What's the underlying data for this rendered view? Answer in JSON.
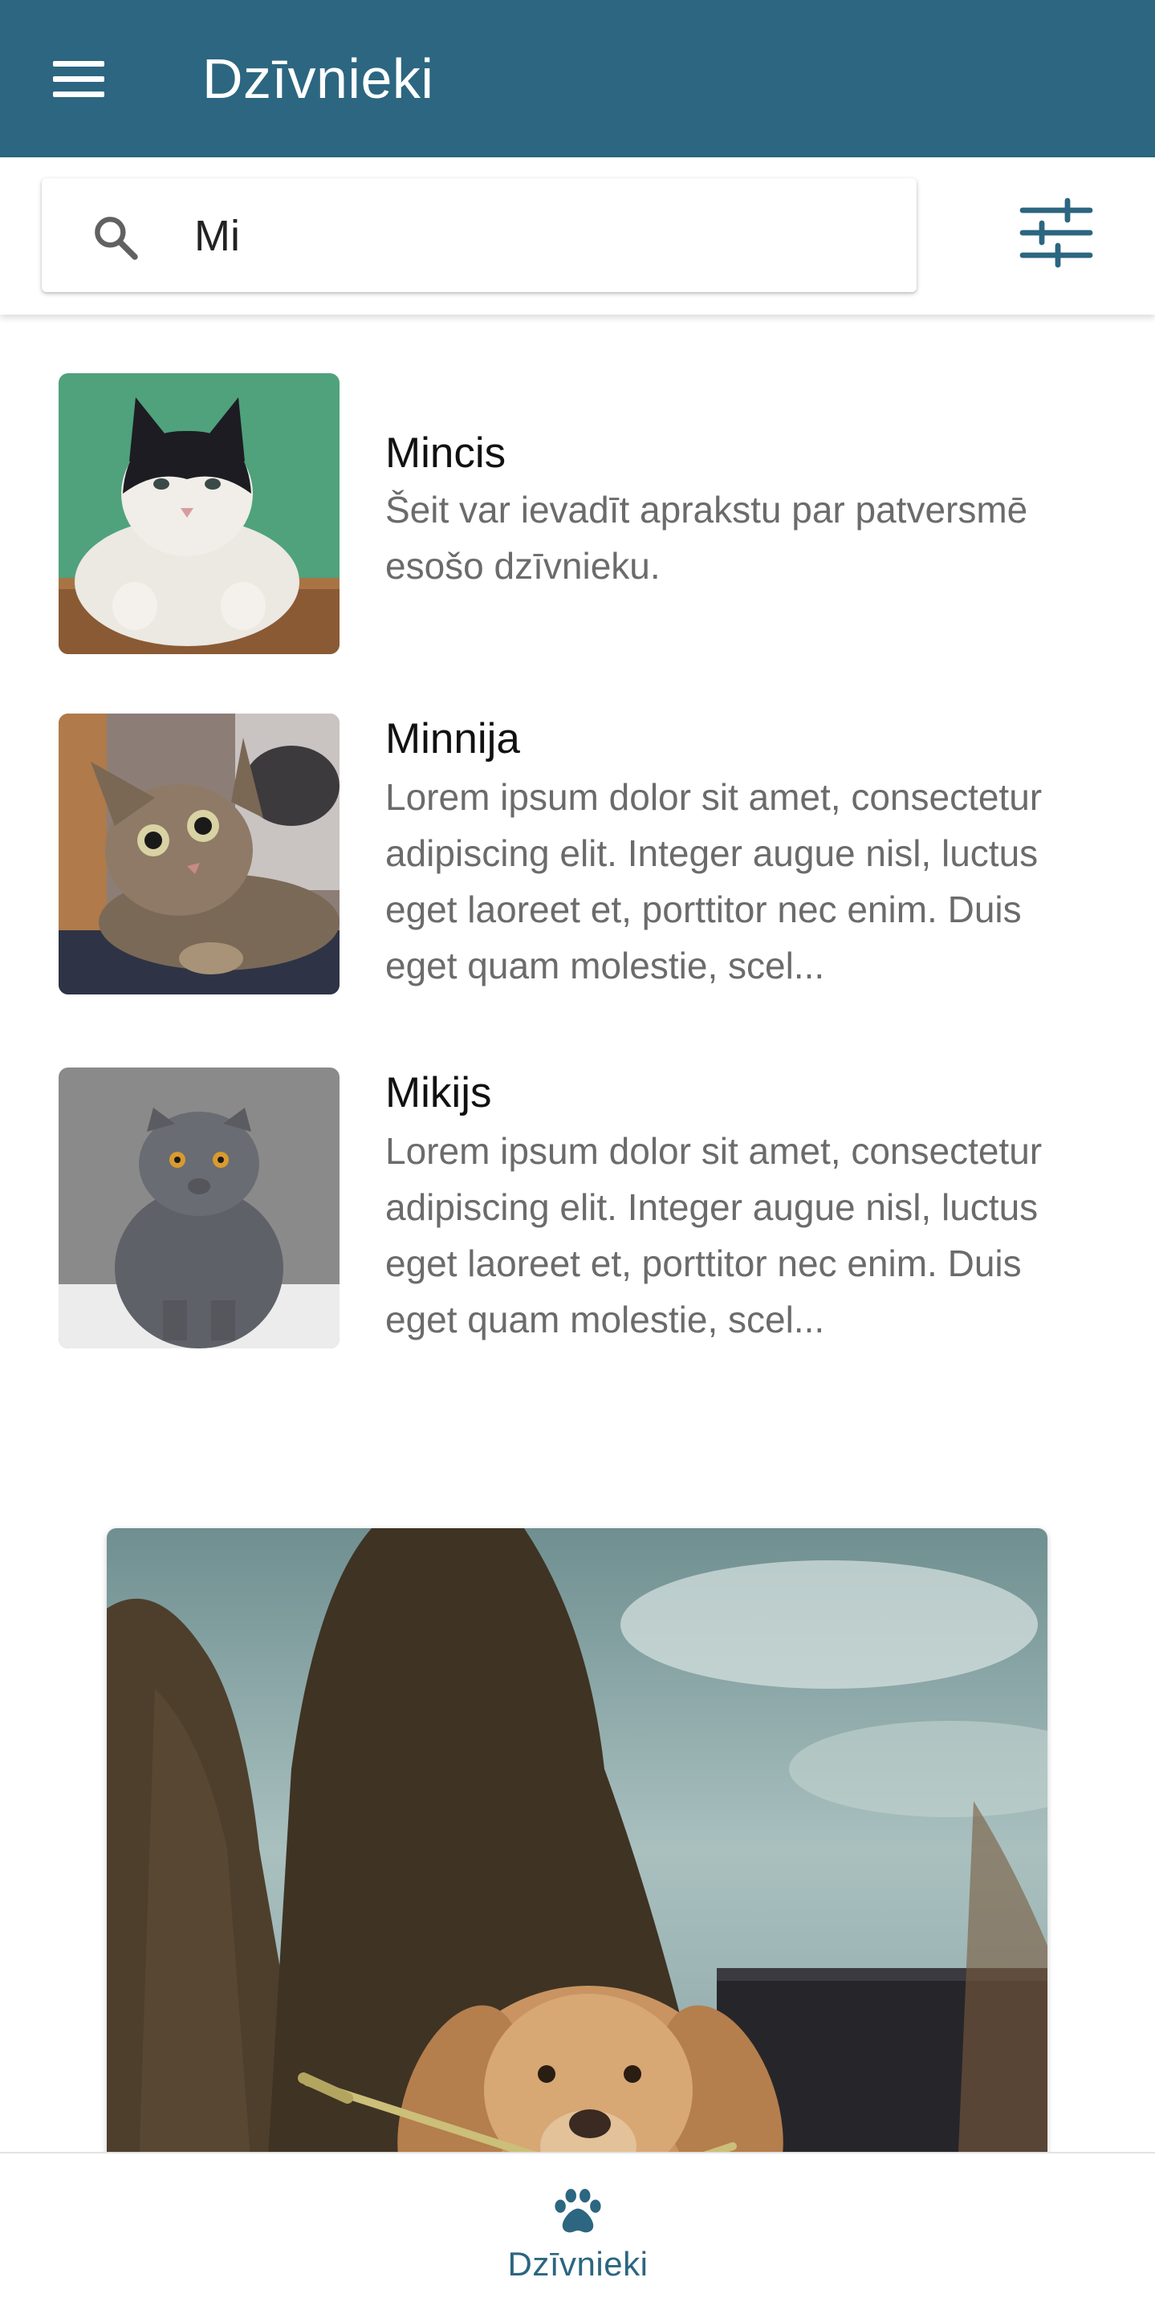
{
  "app_bar": {
    "title": "Dzīvnieki",
    "menu_icon": "hamburger-menu-icon",
    "background_color": "#2c6680"
  },
  "search": {
    "icon": "search-icon",
    "value": "Mi",
    "filter_icon": "tune-sliders-icon"
  },
  "animals": [
    {
      "name": "Mincis",
      "description": "Šeit var ievadīt aprakstu par patversmē esošo dzīvnieku.",
      "photo": "black-white-cat-photo"
    },
    {
      "name": "Minnija",
      "description": "Lorem ipsum dolor sit amet, consectetur adipiscing elit. Integer augue nisl, luctus eget laoreet et, porttitor nec enim. Duis eget quam molestie, scel...",
      "photo": "tabby-cat-photo"
    },
    {
      "name": "Mikijs",
      "description": "Lorem ipsum dolor sit amet, consectetur adipiscing elit. Integer augue nisl, luctus eget laoreet et, porttitor nec enim. Duis eget quam molestie, scel...",
      "photo": "grey-cat-photo"
    }
  ],
  "featured_card": {
    "photo": "golden-dog-with-stick-photo"
  },
  "bottom_nav": {
    "items": [
      {
        "label": "Dzīvnieki",
        "icon": "paw-icon",
        "active": true
      }
    ],
    "accent_color": "#2c6680"
  }
}
